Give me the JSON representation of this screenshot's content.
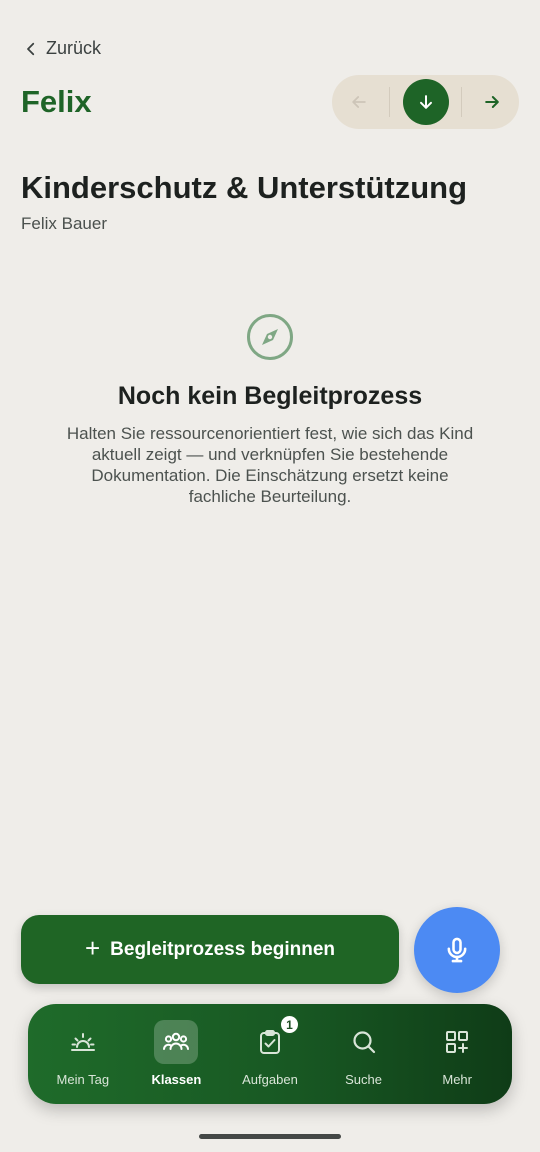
{
  "header": {
    "back_label": "Zurück",
    "child_name": "Felix"
  },
  "pager": {
    "prev_icon": "arrow-left-icon",
    "current_icon": "arrow-down-icon",
    "next_icon": "arrow-right-icon"
  },
  "page": {
    "title": "Kinderschutz & Unterstützung",
    "subtitle": "Felix Bauer"
  },
  "empty_state": {
    "icon": "compass-icon",
    "heading": "Noch kein Begleitprozess",
    "description": "Halten Sie ressourcenorientiert fest, wie sich das Kind aktuell zeigt — und verknüpfen Sie bestehende Dokumentation. Die Einschätzung ersetzt keine fachliche Beurteilung."
  },
  "actions": {
    "start_label": "Begleitprozess beginnen",
    "start_icon": "plus-icon",
    "mic_icon": "microphone-icon"
  },
  "nav": {
    "items": [
      {
        "label": "Mein Tag",
        "icon": "sunrise-icon"
      },
      {
        "label": "Klassen",
        "icon": "group-icon"
      },
      {
        "label": "Aufgaben",
        "icon": "clipboard-check-icon",
        "badge": "1"
      },
      {
        "label": "Suche",
        "icon": "search-icon"
      },
      {
        "label": "Mehr",
        "icon": "grid-plus-icon"
      }
    ]
  },
  "colors": {
    "brand_green": "#1e6427",
    "mic_blue": "#4c8af3",
    "background": "#efede9"
  }
}
